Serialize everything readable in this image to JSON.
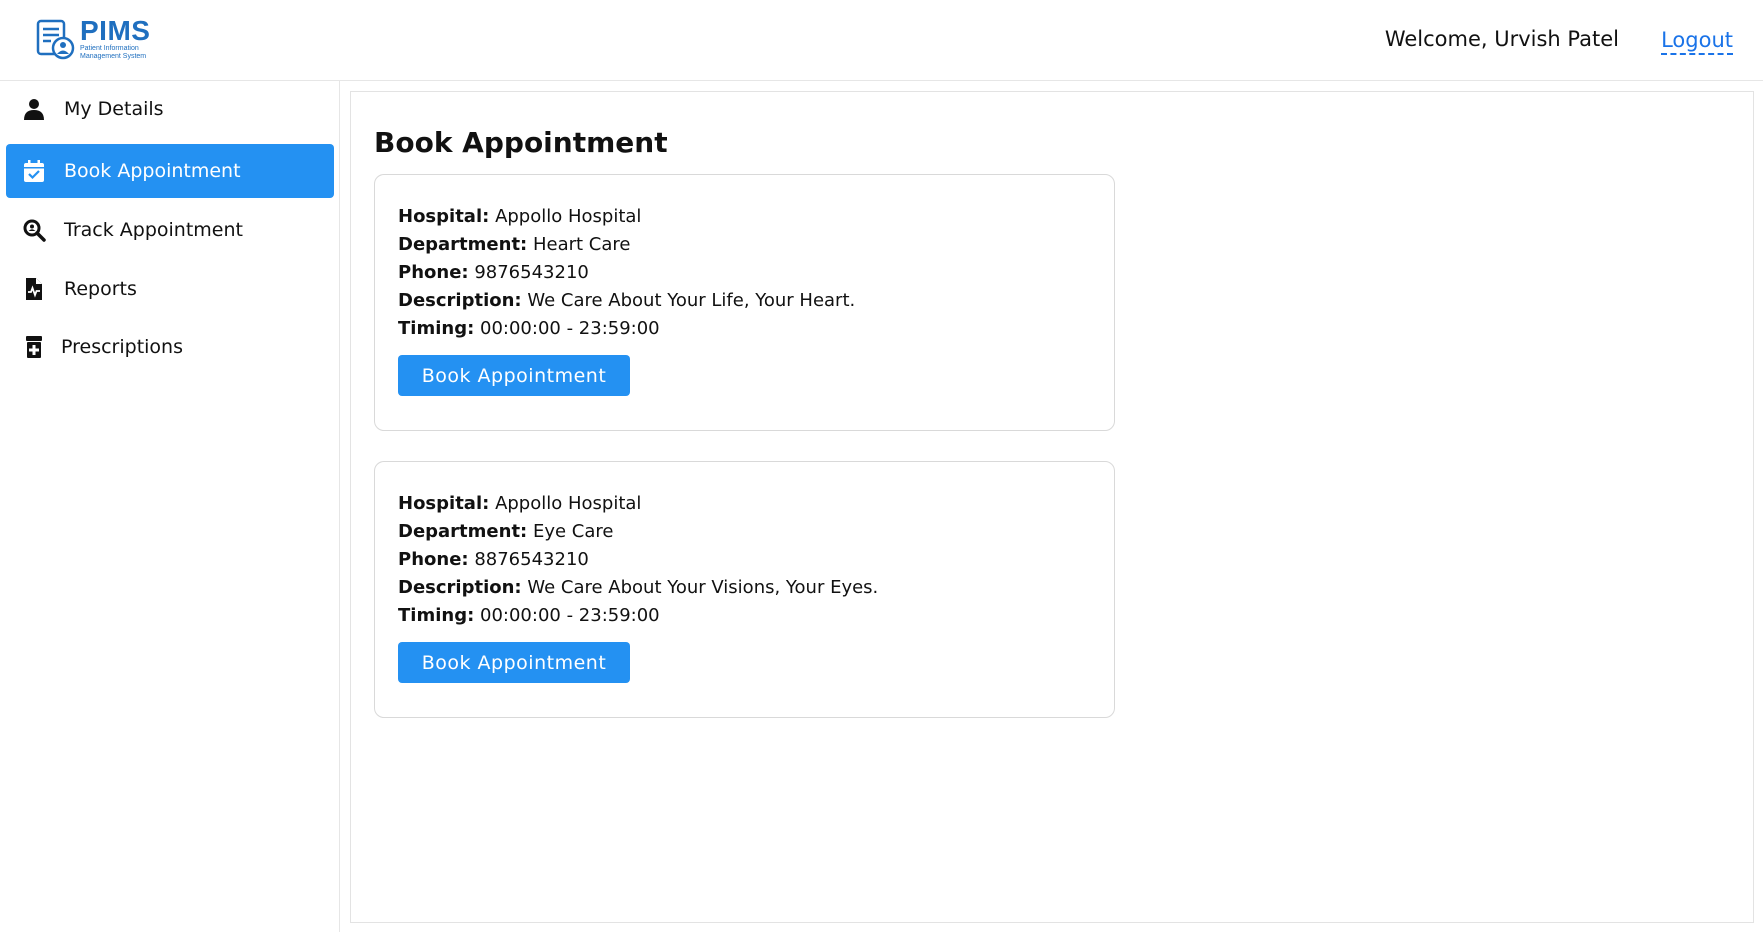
{
  "header": {
    "logo_title": "PIMS",
    "logo_subtitle": "Patient Information Management System",
    "welcome_text": "Welcome, Urvish Patel",
    "logout_label": "Logout"
  },
  "sidebar": {
    "items": [
      {
        "label": "My Details",
        "icon": "user-icon",
        "active": false
      },
      {
        "label": "Book Appointment",
        "icon": "calendar-check-icon",
        "active": true
      },
      {
        "label": "Track Appointment",
        "icon": "search-icon",
        "active": false
      },
      {
        "label": "Reports",
        "icon": "report-file-icon",
        "active": false
      },
      {
        "label": "Prescriptions",
        "icon": "prescription-bottle-icon",
        "active": false
      }
    ]
  },
  "main": {
    "title": "Book Appointment",
    "field_labels": {
      "hospital": "Hospital:",
      "department": "Department:",
      "phone": "Phone:",
      "description": "Description:",
      "timing": "Timing:"
    },
    "cards": [
      {
        "hospital": "Appollo Hospital",
        "department": "Heart Care",
        "phone": "9876543210",
        "description": "We Care About Your Life, Your Heart.",
        "timing": "00:00:00 - 23:59:00",
        "button_label": "Book Appointment"
      },
      {
        "hospital": "Appollo Hospital",
        "department": "Eye Care",
        "phone": "8876543210",
        "description": "We Care About Your Visions, Your Eyes.",
        "timing": "00:00:00 - 23:59:00",
        "button_label": "Book Appointment"
      }
    ]
  },
  "colors": {
    "accent": "#2491f2",
    "brand": "#1f6fbf",
    "link": "#1a73e8"
  }
}
